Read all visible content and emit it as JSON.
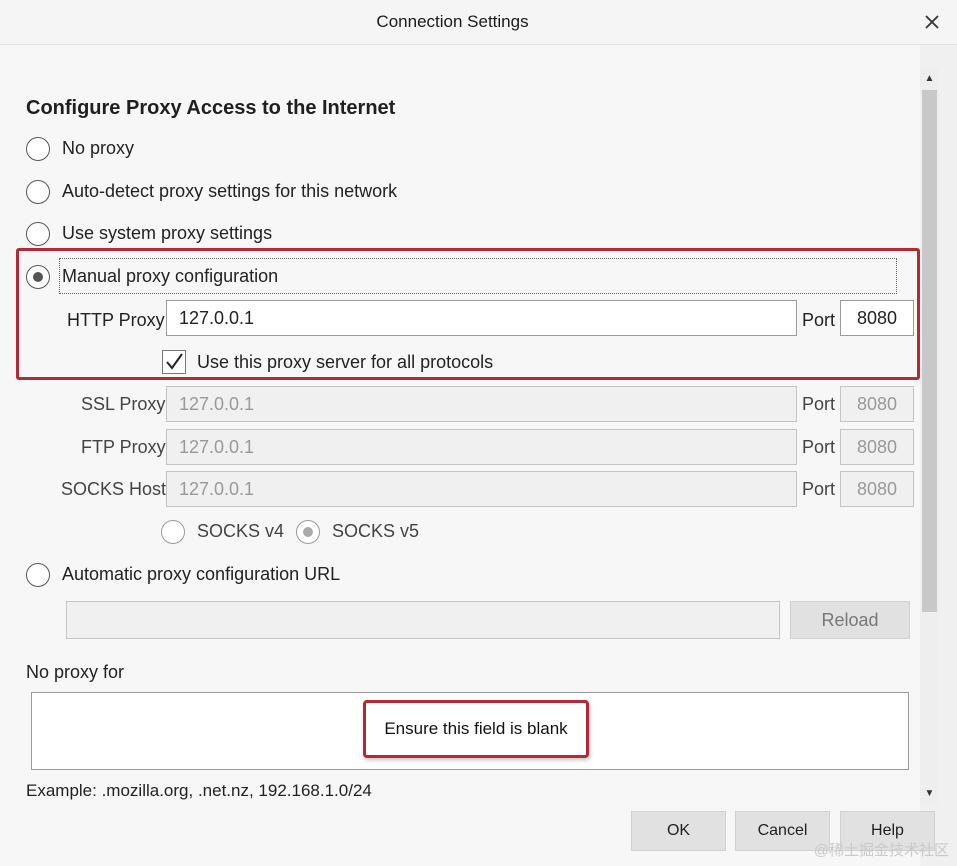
{
  "window": {
    "title": "Connection Settings"
  },
  "heading": "Configure Proxy Access to the Internet",
  "options": {
    "no_proxy": "No proxy",
    "auto_detect": "Auto-detect proxy settings for this network",
    "system": "Use system proxy settings",
    "manual": "Manual proxy configuration",
    "auto_url": "Automatic proxy configuration URL"
  },
  "http": {
    "label": "HTTP Proxy",
    "value": "127.0.0.1",
    "port_label": "Port",
    "port": "8080"
  },
  "use_all": "Use this proxy server for all protocols",
  "ssl": {
    "label": "SSL Proxy",
    "value": "127.0.0.1",
    "port_label": "Port",
    "port": "8080"
  },
  "ftp": {
    "label": "FTP Proxy",
    "value": "127.0.0.1",
    "port_label": "Port",
    "port": "8080"
  },
  "socks": {
    "label": "SOCKS Host",
    "value": "127.0.0.1",
    "port_label": "Port",
    "port": "8080",
    "v4": "SOCKS v4",
    "v5": "SOCKS v5"
  },
  "auto_url_value": "",
  "reload": "Reload",
  "no_proxy_for": {
    "label": "No proxy for",
    "value": "",
    "example": "Example: .mozilla.org, .net.nz, 192.168.1.0/24"
  },
  "callout": "Ensure this field is blank",
  "buttons": {
    "ok": "OK",
    "cancel": "Cancel",
    "help": "Help"
  },
  "watermark": "@稀土掘金技术社区",
  "colors": {
    "annotation_red": "#b02c35"
  }
}
